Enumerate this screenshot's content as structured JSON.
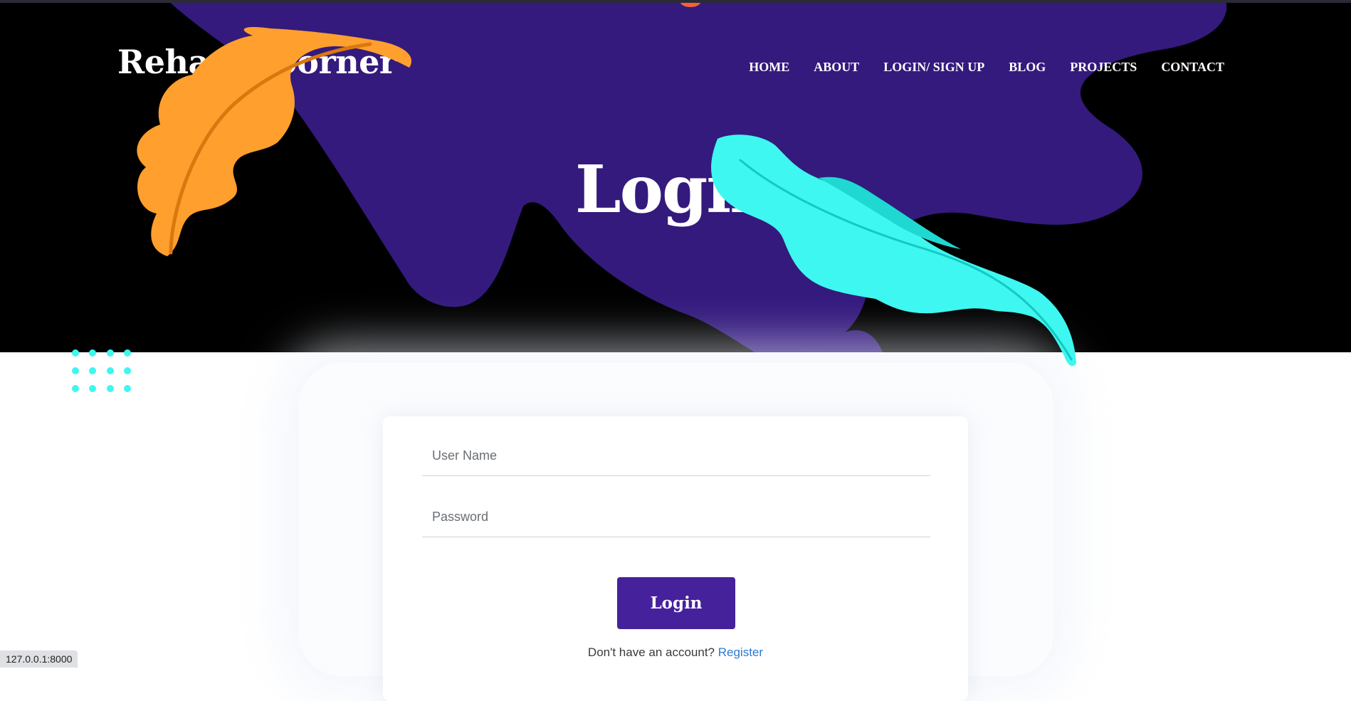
{
  "site": {
    "brand": "Rehan's Corner",
    "nav": [
      "HOME",
      "ABOUT",
      "LOGIN/ SIGN UP",
      "BLOG",
      "PROJECTS",
      "CONTACT"
    ]
  },
  "hero": {
    "title": "Login"
  },
  "form": {
    "username_placeholder": "User Name",
    "password_placeholder": "Password",
    "submit_label": "Login",
    "register_prompt": "Don't have an account?",
    "register_link": "Register"
  },
  "status_bar": {
    "url": "127.0.0.1:8000"
  },
  "colors": {
    "hero_bg": "#000000",
    "purple_blob": "#341a7d",
    "orange_leaf": "#ff9f2e",
    "cyan_leaf": "#3ef7f0",
    "button": "#45219b",
    "link": "#2a7ad6"
  },
  "icons": [
    "orange-leaf-decoration",
    "cyan-leaf-decoration",
    "dot-grid-decoration"
  ]
}
